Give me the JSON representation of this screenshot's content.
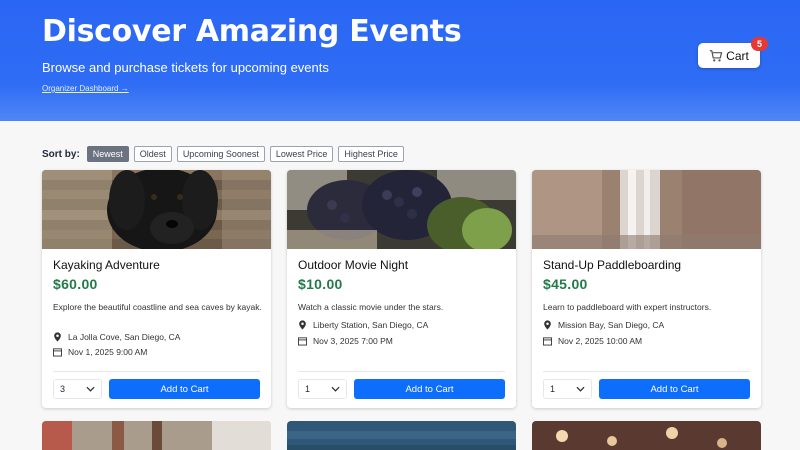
{
  "hero": {
    "title": "Discover Amazing Events",
    "subtitle": "Browse and purchase tickets for upcoming events",
    "organizer_link": "Organizer Dashboard →"
  },
  "cart": {
    "label": "Cart",
    "count": "5",
    "icon": "cart-icon"
  },
  "sort": {
    "label": "Sort by:",
    "options": [
      "Newest",
      "Oldest",
      "Upcoming Soonest",
      "Lowest Price",
      "Highest Price"
    ],
    "active": "Newest"
  },
  "events": [
    {
      "title": "Kayaking Adventure",
      "price": "$60.00",
      "description": "Explore the beautiful coastline and sea caves by kayak.",
      "location": "La Jolla Cove, San Diego, CA",
      "date": "Nov 1, 2025 9:00 AM",
      "quantity": "3",
      "button": "Add to Cart",
      "image": "black-dog-photo"
    },
    {
      "title": "Outdoor Movie Night",
      "price": "$10.00",
      "description": "Watch a classic movie under the stars.",
      "location": "Liberty Station, San Diego, CA",
      "date": "Nov 3, 2025 7:00 PM",
      "quantity": "1",
      "button": "Add to Cart",
      "image": "grapes-photo"
    },
    {
      "title": "Stand-Up Paddleboarding",
      "price": "$45.00",
      "description": "Learn to paddleboard with expert instructors.",
      "location": "Mission Bay, San Diego, CA",
      "date": "Nov 2, 2025 10:00 AM",
      "quantity": "1",
      "button": "Add to Cart",
      "image": "waterfall-photo"
    }
  ],
  "colors": {
    "accent": "#0d6efd",
    "price": "#237a4b",
    "hero": "#2f6df5",
    "badge": "#e53935"
  }
}
